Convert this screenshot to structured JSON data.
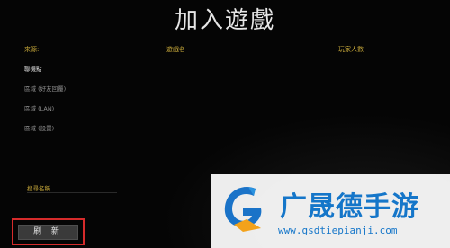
{
  "window": {
    "title": "加入遊戲"
  },
  "columns": {
    "source": "來源:",
    "game_name": "遊戲名",
    "players": "玩家人數"
  },
  "sources": [
    {
      "label": "聯機點",
      "active": true
    },
    {
      "label": "區域 (好友回覆)",
      "active": false
    },
    {
      "label": "區域 (LAN)",
      "active": false
    },
    {
      "label": "區域 (設置)",
      "active": false
    }
  ],
  "search": {
    "label": "搜尋名稱"
  },
  "actions": {
    "refresh_label": "刷 新"
  },
  "highlight_color": "#d62b2b",
  "watermark": {
    "name": "广晟德手游",
    "url": "www.gsdtiepianji.com",
    "color": "#1576c9",
    "logo_icon": "gsd-logo-icon"
  }
}
